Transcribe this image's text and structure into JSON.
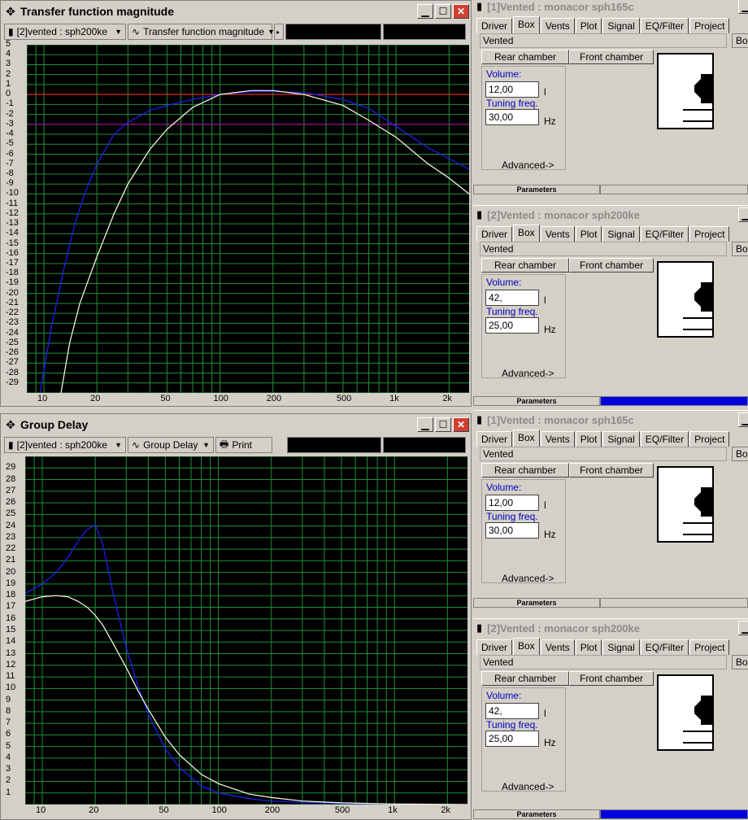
{
  "windows": {
    "transfer": {
      "title": "Transfer function magnitude",
      "selector": "[2]vented : sph200ke",
      "plot_selector": "Transfer function magnitude"
    },
    "delay": {
      "title": "Group Delay",
      "selector": "[2]vented : sph200ke",
      "plot_selector": "Group Delay",
      "print_label": "Print"
    }
  },
  "param_panels": [
    {
      "title": "[1]Vented : monacor sph165c",
      "tabs": [
        "Driver",
        "Box",
        "Vents",
        "Plot",
        "Signal",
        "EQ/Filter",
        "Project"
      ],
      "box_type": "Vented",
      "bo": "Bo",
      "rear": "Rear chamber",
      "front": "Front chamber",
      "volume_label": "Volume:",
      "volume": "12,00",
      "volume_unit": "l",
      "tuning_label": "Tuning freq.",
      "tuning": "30,00",
      "tuning_unit": "Hz",
      "advanced": "Advanced->",
      "params": "Parameters",
      "progress": 0
    },
    {
      "title": "[2]Vented : monacor sph200ke",
      "tabs": [
        "Driver",
        "Box",
        "Vents",
        "Plot",
        "Signal",
        "EQ/Filter",
        "Project"
      ],
      "box_type": "Vented",
      "bo": "Bo",
      "rear": "Rear chamber",
      "front": "Front chamber",
      "volume_label": "Volume:",
      "volume": "42,",
      "volume_unit": "l",
      "tuning_label": "Tuning freq.",
      "tuning": "25,00",
      "tuning_unit": "Hz",
      "advanced": "Advanced->",
      "params": "Parameters",
      "progress": 1
    },
    {
      "title": "[1]Vented : monacor sph165c",
      "tabs": [
        "Driver",
        "Box",
        "Vents",
        "Plot",
        "Signal",
        "EQ/Filter",
        "Project"
      ],
      "box_type": "Vented",
      "bo": "Bo",
      "rear": "Rear chamber",
      "front": "Front chamber",
      "volume_label": "Volume:",
      "volume": "12,00",
      "volume_unit": "l",
      "tuning_label": "Tuning freq.",
      "tuning": "30,00",
      "tuning_unit": "Hz",
      "advanced": "Advanced->",
      "params": "Parameters",
      "progress": 0
    },
    {
      "title": "[2]Vented : monacor sph200ke",
      "tabs": [
        "Driver",
        "Box",
        "Vents",
        "Plot",
        "Signal",
        "EQ/Filter",
        "Project"
      ],
      "box_type": "Vented",
      "bo": "Bo",
      "rear": "Rear chamber",
      "front": "Front chamber",
      "volume_label": "Volume:",
      "volume": "42,",
      "volume_unit": "l",
      "tuning_label": "Tuning freq.",
      "tuning": "25,00",
      "tuning_unit": "Hz",
      "advanced": "Advanced->",
      "params": "Parameters",
      "progress": 1
    }
  ],
  "icons": {
    "move": "crosshair-move-icon",
    "minimize": "minimize-icon",
    "maximize": "maximize-icon",
    "close": "close-icon"
  },
  "chart_data": [
    {
      "type": "line",
      "x_scale": "log",
      "xlim": [
        8,
        2600
      ],
      "ylim": [
        -30,
        5
      ],
      "x_ticks": [
        10,
        20,
        50,
        100,
        200,
        500,
        1000,
        2000
      ],
      "x_tick_labels": [
        "10",
        "20",
        "50",
        "100",
        "200",
        "500",
        "1k",
        "2k"
      ],
      "y_ticks": [
        5,
        4,
        3,
        2,
        1,
        0,
        -1,
        -2,
        -3,
        -4,
        -5,
        -6,
        -7,
        -8,
        -9,
        -10,
        -11,
        -12,
        -13,
        -14,
        -15,
        -16,
        -17,
        -18,
        -19,
        -20,
        -21,
        -22,
        -23,
        -24,
        -25,
        -26,
        -27,
        -28,
        -29
      ],
      "reference_lines": [
        {
          "y": 0,
          "color": "#ff2020"
        },
        {
          "y": -3,
          "color": "#c000c0"
        }
      ],
      "grid": true,
      "series": [
        {
          "color": "#2020ff",
          "x": [
            9.5,
            11,
            13,
            15,
            17,
            20,
            25,
            30,
            40,
            50,
            70,
            100,
            150,
            200,
            300,
            500,
            700,
            1000,
            1500,
            2600
          ],
          "y": [
            -30,
            -23.5,
            -17.5,
            -13,
            -10,
            -7,
            -4,
            -2.8,
            -1.6,
            -1.1,
            -0.5,
            0,
            0.3,
            0.3,
            0.2,
            -0.5,
            -1.4,
            -3.2,
            -5.3,
            -7.5
          ]
        },
        {
          "color": "#ffffe0",
          "x": [
            12.5,
            14,
            16,
            18,
            20,
            25,
            30,
            40,
            50,
            70,
            100,
            150,
            200,
            300,
            500,
            700,
            1000,
            1500,
            2000,
            2600
          ],
          "y": [
            -30,
            -25,
            -21,
            -18.5,
            -16.3,
            -12,
            -9,
            -5.5,
            -3.5,
            -1.3,
            0,
            0.4,
            0.4,
            0,
            -1.1,
            -2.6,
            -4.3,
            -6.9,
            -8.4,
            -10
          ]
        }
      ]
    },
    {
      "type": "line",
      "x_scale": "log",
      "xlim": [
        8,
        2600
      ],
      "ylim": [
        0,
        30
      ],
      "x_ticks": [
        10,
        20,
        50,
        100,
        200,
        500,
        1000,
        2000
      ],
      "x_tick_labels": [
        "10",
        "20",
        "50",
        "100",
        "200",
        "500",
        "1k",
        "2k"
      ],
      "y_ticks": [
        29,
        28,
        27,
        26,
        25,
        24,
        23,
        22,
        21,
        20,
        19,
        18,
        17,
        16,
        15,
        14,
        13,
        12,
        11,
        10,
        9,
        8,
        7,
        6,
        5,
        4,
        3,
        2,
        1
      ],
      "grid": true,
      "series": [
        {
          "color": "#2020ff",
          "x": [
            8,
            10,
            12,
            14,
            16,
            18,
            20,
            22,
            25,
            30,
            35,
            40,
            50,
            60,
            80,
            100,
            150,
            200,
            300,
            500,
            1000,
            2600
          ],
          "y": [
            18.2,
            19,
            20,
            21.3,
            22.7,
            23.7,
            24.1,
            22.5,
            18.5,
            13.5,
            10.2,
            7.8,
            4.8,
            3.2,
            1.6,
            1,
            0.5,
            0.3,
            0.2,
            0.1,
            0.05,
            0
          ]
        },
        {
          "color": "#ffffe0",
          "x": [
            8,
            10,
            12,
            14,
            16,
            18,
            20,
            22,
            25,
            30,
            35,
            40,
            50,
            60,
            80,
            100,
            150,
            200,
            300,
            500,
            1000,
            2600
          ],
          "y": [
            17.5,
            17.9,
            18,
            17.9,
            17.5,
            17,
            16.3,
            15.5,
            14,
            11.8,
            9.8,
            8.2,
            5.8,
            4.3,
            2.6,
            1.8,
            0.9,
            0.6,
            0.3,
            0.15,
            0.05,
            0
          ]
        }
      ]
    }
  ]
}
